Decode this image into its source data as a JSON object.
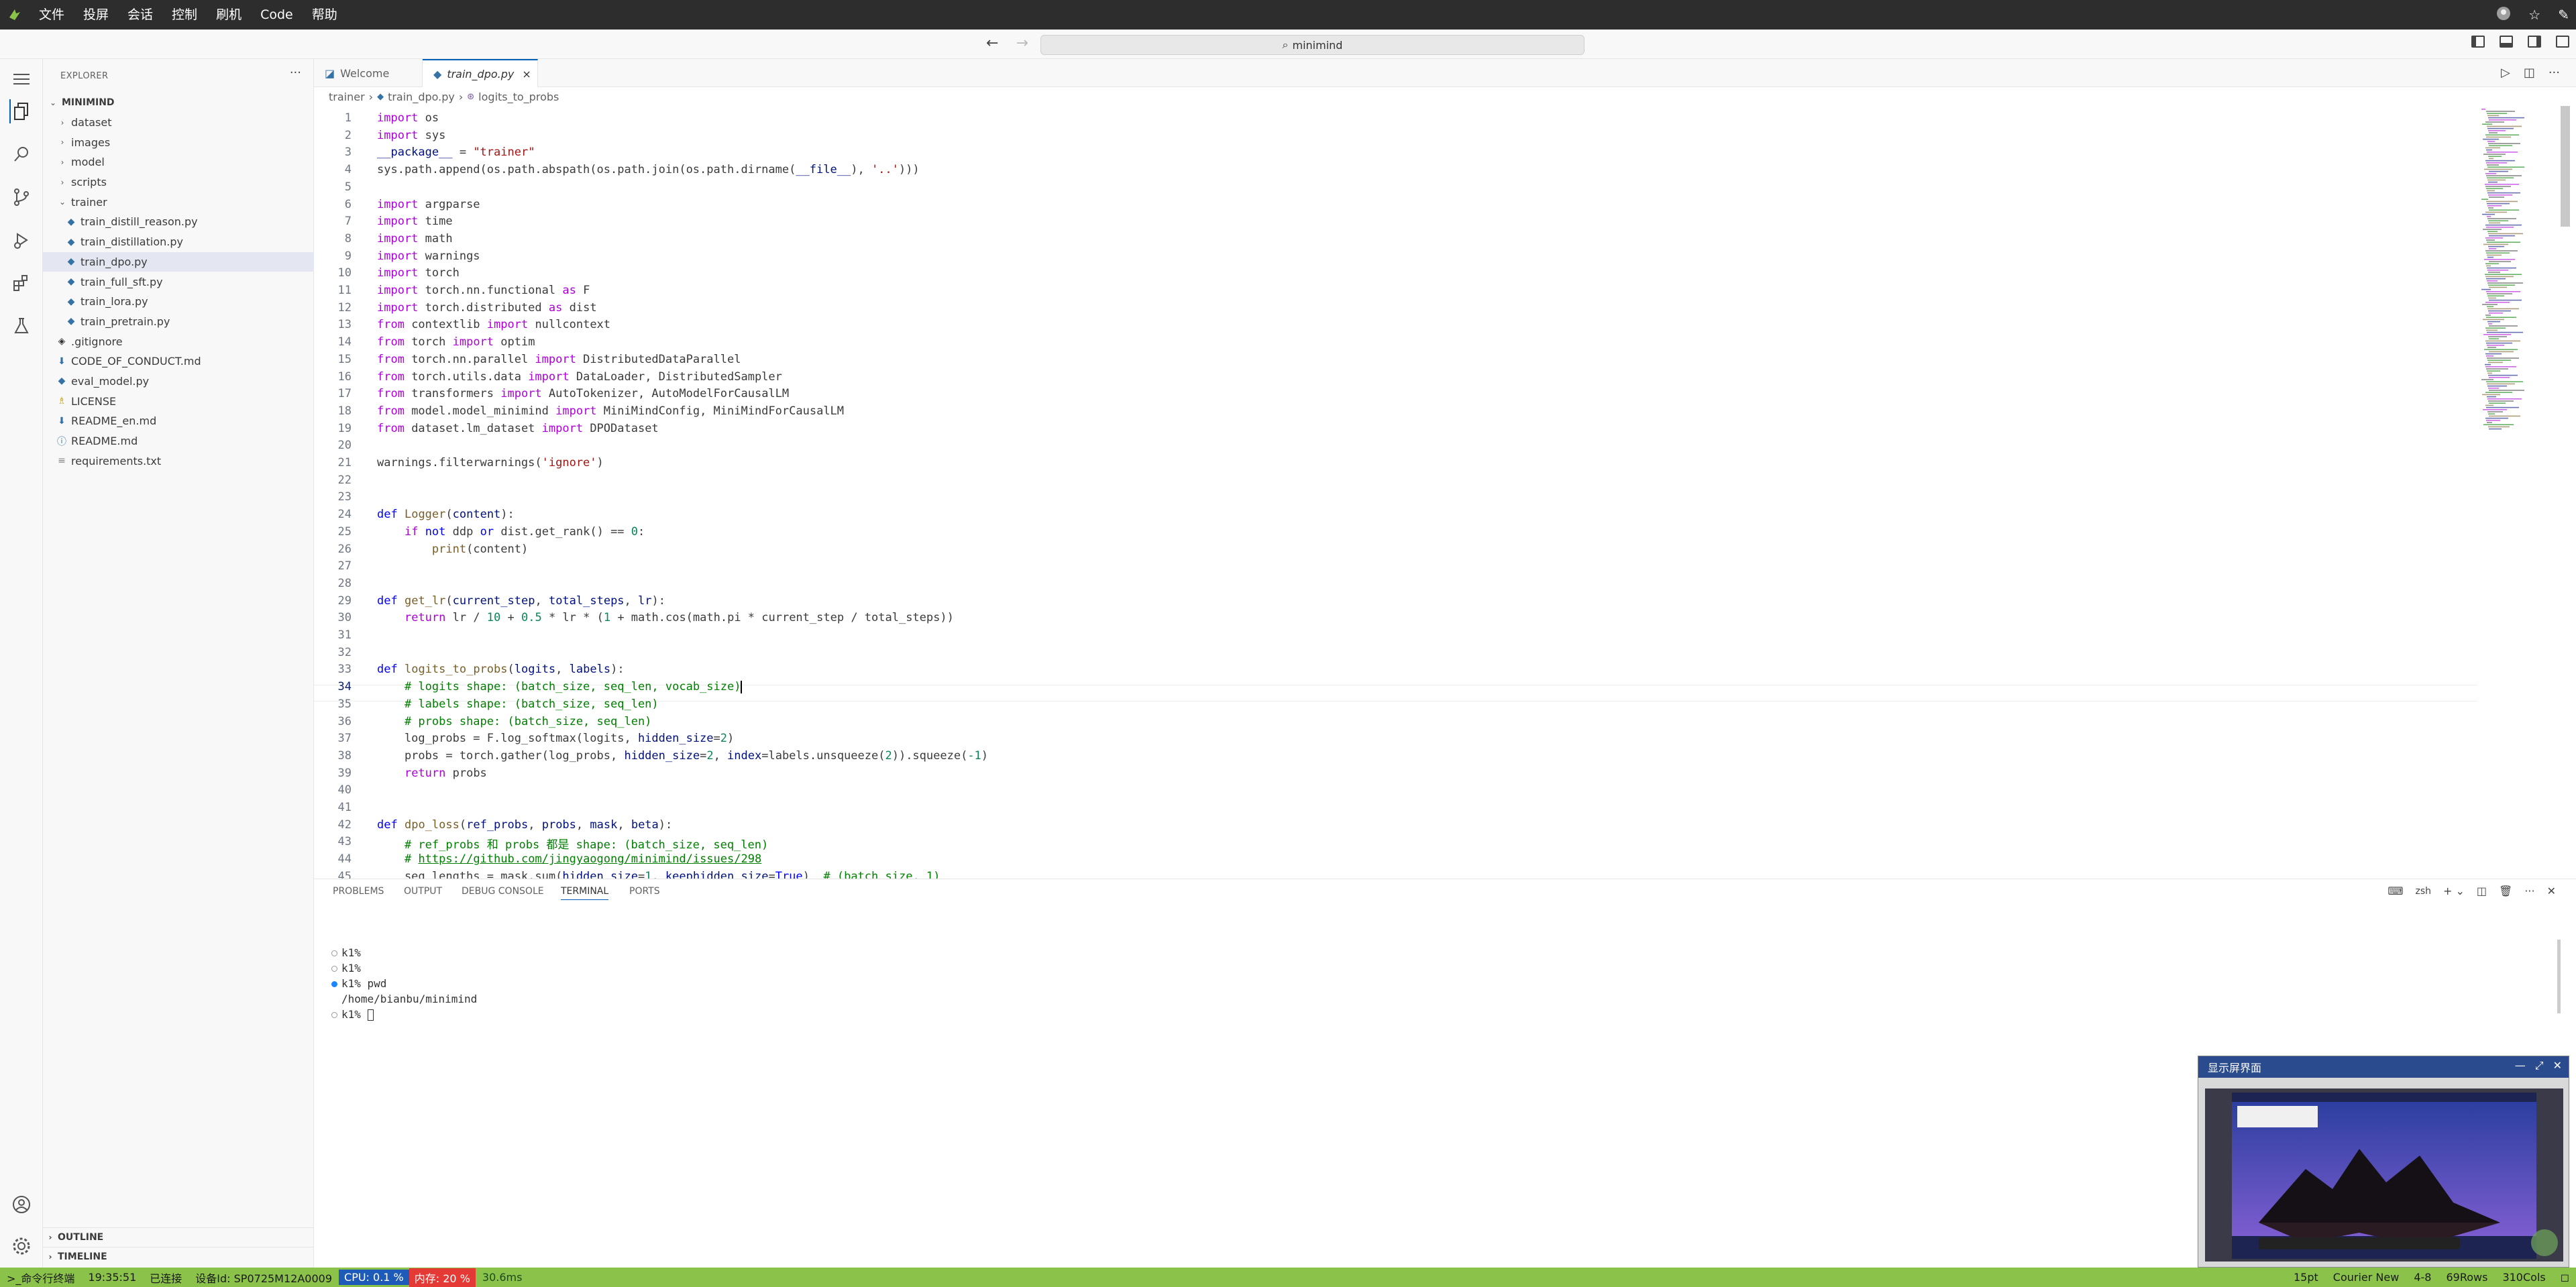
{
  "sysbar": {
    "menus": [
      "文件",
      "投屏",
      "会话",
      "控制",
      "刷机",
      "Code",
      "帮助"
    ]
  },
  "titlebar": {
    "search_text": "minimind"
  },
  "sidebar": {
    "header": "EXPLORER",
    "root": "MINIMIND",
    "items": [
      {
        "label": "dataset",
        "type": "folder",
        "open": false
      },
      {
        "label": "images",
        "type": "folder",
        "open": false
      },
      {
        "label": "model",
        "type": "folder",
        "open": false
      },
      {
        "label": "scripts",
        "type": "folder",
        "open": false
      },
      {
        "label": "trainer",
        "type": "folder",
        "open": true
      },
      {
        "label": "train_distill_reason.py",
        "type": "py",
        "indent": 2
      },
      {
        "label": "train_distillation.py",
        "type": "py",
        "indent": 2
      },
      {
        "label": "train_dpo.py",
        "type": "py",
        "indent": 2,
        "selected": true
      },
      {
        "label": "train_full_sft.py",
        "type": "py",
        "indent": 2
      },
      {
        "label": "train_lora.py",
        "type": "py",
        "indent": 2
      },
      {
        "label": "train_pretrain.py",
        "type": "py",
        "indent": 2
      },
      {
        "label": ".gitignore",
        "type": "git",
        "indent": 1
      },
      {
        "label": "CODE_OF_CONDUCT.md",
        "type": "md",
        "indent": 1
      },
      {
        "label": "eval_model.py",
        "type": "py",
        "indent": 1
      },
      {
        "label": "LICENSE",
        "type": "license",
        "indent": 1
      },
      {
        "label": "README_en.md",
        "type": "md",
        "indent": 1
      },
      {
        "label": "README.md",
        "type": "info",
        "indent": 1
      },
      {
        "label": "requirements.txt",
        "type": "txt",
        "indent": 1
      }
    ],
    "outline": "OUTLINE",
    "timeline": "TIMELINE"
  },
  "tabs": [
    {
      "label": "Welcome"
    },
    {
      "label": "train_dpo.py",
      "active": true
    }
  ],
  "breadcrumb": [
    "trainer",
    "train_dpo.py",
    "logits_to_probs"
  ],
  "editor": {
    "current_line": 34,
    "lines": [
      "<span class='kw'>import</span> os",
      "<span class='kw'>import</span> sys",
      "<span class='var'>__package__</span> = <span class='str'>\"trainer\"</span>",
      "sys.path.append(os.path.abspath(os.path.join(os.path.dirname(<span class='var'>__file__</span>), <span class='str'>'..'</span>)))",
      "",
      "<span class='kw'>import</span> argparse",
      "<span class='kw'>import</span> time",
      "<span class='kw'>import</span> math",
      "<span class='kw'>import</span> warnings",
      "<span class='kw'>import</span> torch",
      "<span class='kw'>import</span> torch.nn.functional <span class='kw'>as</span> F",
      "<span class='kw'>import</span> torch.distributed <span class='kw'>as</span> dist",
      "<span class='kw'>from</span> contextlib <span class='kw'>import</span> nullcontext",
      "<span class='kw'>from</span> torch <span class='kw'>import</span> optim",
      "<span class='kw'>from</span> torch.nn.parallel <span class='kw'>import</span> DistributedDataParallel",
      "<span class='kw'>from</span> torch.utils.data <span class='kw'>import</span> DataLoader, DistributedSampler",
      "<span class='kw'>from</span> transformers <span class='kw'>import</span> AutoTokenizer, AutoModelForCausalLM",
      "<span class='kw'>from</span> model.model_minimind <span class='kw'>import</span> MiniMindConfig, MiniMindForCausalLM",
      "<span class='kw'>from</span> dataset.lm_dataset <span class='kw'>import</span> DPODataset",
      "",
      "warnings.filterwarnings(<span class='str'>'ignore'</span>)",
      "",
      "",
      "<span class='kw2'>def</span> <span class='fn'>Logger</span>(<span class='var'>content</span>):",
      "    <span class='kw'>if</span> <span class='kw2'>not</span> ddp <span class='kw2'>or</span> dist.get_rank() == <span class='num'>0</span>:",
      "        <span class='fn'>print</span>(content)",
      "",
      "",
      "<span class='kw2'>def</span> <span class='fn'>get_lr</span>(<span class='var'>current_step</span>, <span class='var'>total_steps</span>, <span class='var'>lr</span>):",
      "    <span class='kw'>return</span> lr / <span class='num'>10</span> + <span class='num'>0.5</span> * lr * (<span class='num'>1</span> + math.cos(math.pi * current_step / total_steps))",
      "",
      "",
      "<span class='kw2'>def</span> <span class='fn'>logits_to_probs</span>(<span class='var'>logits</span>, <span class='var'>labels</span>):",
      "    <span class='cm'># logits shape: (batch_size, seq_len, vocab_size)</span>",
      "    <span class='cm'># labels shape: (batch_size, seq_len)</span>",
      "    <span class='cm'># probs shape: (batch_size, seq_len)</span>",
      "    log_probs = F.log_softmax(logits, <span class='var'>hidden_size</span>=<span class='num'>2</span>)",
      "    probs = torch.gather(log_probs, <span class='var'>hidden_size</span>=<span class='num'>2</span>, <span class='var'>index</span>=labels.unsqueeze(<span class='num'>2</span>)).squeeze(<span class='num'>-1</span>)",
      "    <span class='kw'>return</span> probs",
      "",
      "",
      "<span class='kw2'>def</span> <span class='fn'>dpo_loss</span>(<span class='var'>ref_probs</span>, <span class='var'>probs</span>, <span class='var'>mask</span>, <span class='var'>beta</span>):",
      "    <span class='cm'># ref_probs 和 probs 都是 shape: (batch_size, seq_len)</span>",
      "    <span class='cm'># </span><span class='lnk'>https://github.com/jingyaogong/minimind/issues/298</span>",
      "    seq_lengths = mask.sum(<span class='var'>hidden_size</span>=<span class='num'>1</span>, <span class='var'>keephidden_size</span>=<span class='kw2'>True</span>)  <span class='cm'># (batch_size, 1)</span>"
    ]
  },
  "panel": {
    "tabs": [
      "PROBLEMS",
      "OUTPUT",
      "DEBUG CONSOLE",
      "TERMINAL",
      "PORTS"
    ],
    "active_tab": "TERMINAL",
    "shell": "zsh",
    "terminal": [
      {
        "text": "k1%",
        "dot": "hollow"
      },
      {
        "text": "k1%",
        "dot": "hollow"
      },
      {
        "text": "k1% pwd",
        "dot": "blue"
      },
      {
        "text": "/home/bianbu/minimind",
        "dot": "none"
      },
      {
        "text": "k1% ",
        "dot": "hollow",
        "cursor": true
      }
    ]
  },
  "popup": {
    "title": "显示屏界面"
  },
  "status": {
    "terminal": "命令行终端",
    "time": "19:35:51",
    "connection": "已连接",
    "device": "设备Id: SP0725M12A0009",
    "cpu": "CPU: 0.1 %",
    "memory": "内存: 20 %",
    "latency": "30.6ms",
    "font_size": "15pt",
    "font_name": "Courier New",
    "pos": "4-8",
    "rows": "69Rows",
    "cols": "310Cols"
  },
  "colors": {
    "accent": "#005fb8",
    "status_bg": "#8bc34a",
    "cpu_bg": "#1e5bb8",
    "mem_bg": "#e53935",
    "popup_title": "#2a4b8d"
  }
}
